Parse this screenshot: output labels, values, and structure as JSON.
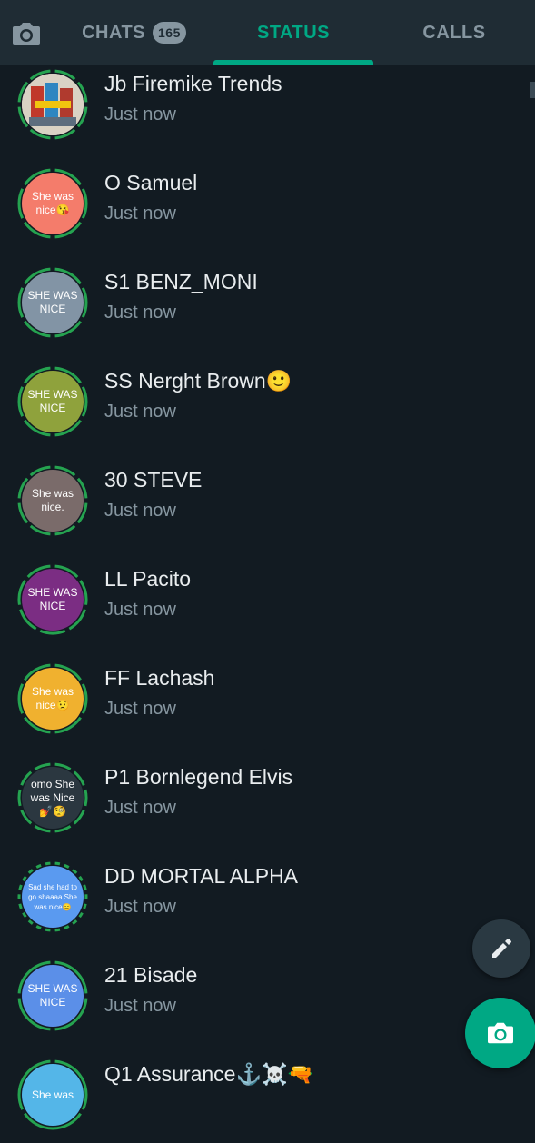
{
  "tabs": {
    "camera_icon": "camera-icon",
    "chats": "CHATS",
    "chats_badge": "165",
    "status": "STATUS",
    "calls": "CALLS"
  },
  "colors": {
    "accent": "#00a884",
    "background": "#121b22",
    "header": "#1f2c34"
  },
  "statuses": [
    {
      "name": "Jb Firemike Trends",
      "time": "Just now",
      "avatar_text": "",
      "avatar_color": "#d9d2c4",
      "photo": true
    },
    {
      "name": "O Samuel",
      "time": "Just now",
      "avatar_text": "She was nice😘",
      "avatar_color": "#f47c6b"
    },
    {
      "name": "S1 BENZ_MONI",
      "time": "Just now",
      "avatar_text": "SHE WAS NICE",
      "avatar_color": "#8294a5"
    },
    {
      "name": "SS Nerght Brown🙂",
      "time": "Just now",
      "avatar_text": "SHE WAS NICE",
      "avatar_color": "#8fa23c"
    },
    {
      "name": "30 STEVE",
      "time": "Just now",
      "avatar_text": "She was nice.",
      "avatar_color": "#7a6b6a"
    },
    {
      "name": "LL Pacito",
      "time": "Just now",
      "avatar_text": "SHE WAS NICE",
      "avatar_color": "#7b2d83"
    },
    {
      "name": "FF Lachash",
      "time": "Just now",
      "avatar_text": "She was nice😟",
      "avatar_color": "#f0b12f"
    },
    {
      "name": "P1 Bornlegend Elvis",
      "time": "Just now",
      "avatar_text": "omo She was Nice 💅🧐",
      "avatar_color": "#2b3740"
    },
    {
      "name": "DD MORTAL ALPHA",
      "time": "Just now",
      "avatar_text": "Sad she had to go shaaaa She was nice😑",
      "avatar_color": "#5a9af0"
    },
    {
      "name": "21 Bisade",
      "time": "Just now",
      "avatar_text": "SHE WAS NICE",
      "avatar_color": "#5b8fe8"
    },
    {
      "name": "Q1 Assurance⚓☠️🔫",
      "time": "",
      "avatar_text": "She was",
      "avatar_color": "#54b6e8"
    }
  ],
  "fabs": {
    "edit_icon": "pencil-icon",
    "camera_icon": "camera-icon"
  }
}
